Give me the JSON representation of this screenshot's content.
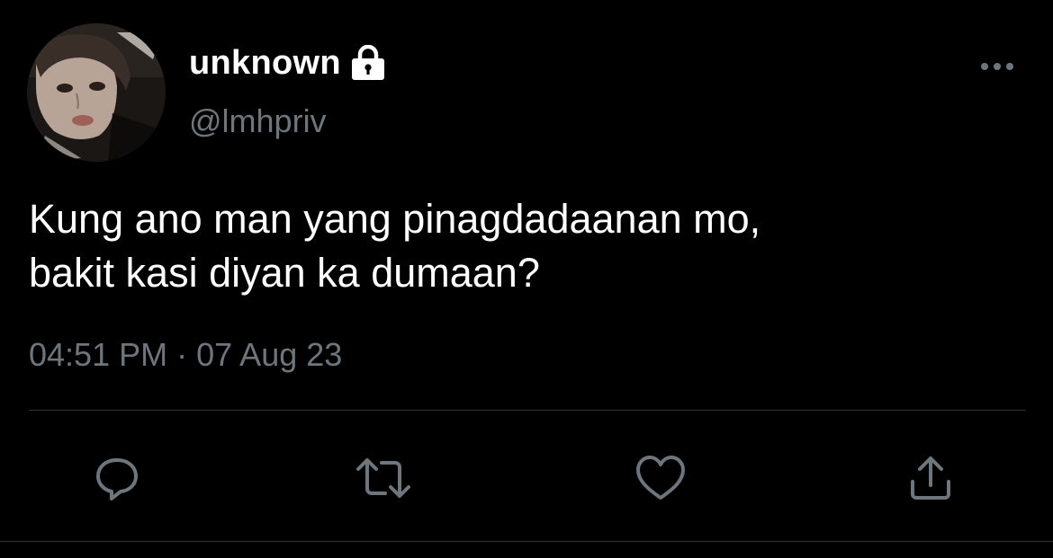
{
  "tweet": {
    "author": {
      "display_name": "unknown",
      "handle": "@lmhpriv",
      "protected_icon": "lock-icon",
      "avatar": "profile-photo"
    },
    "text_lines": [
      "Kung ano man yang pinagdadaanan mo,",
      "bakit kasi diyan ka dumaan?"
    ],
    "time": "04:51 PM",
    "separator": "·",
    "date": "07 Aug 23"
  },
  "actions": [
    {
      "icon": "reply-icon"
    },
    {
      "icon": "retweet-icon"
    },
    {
      "icon": "like-icon"
    },
    {
      "icon": "share-icon"
    }
  ],
  "more_menu_icon": "more-options-icon",
  "colors": {
    "background": "#000000",
    "text_primary": "#ffffff",
    "text_secondary": "#6e767d",
    "divider": "#2f3336"
  }
}
